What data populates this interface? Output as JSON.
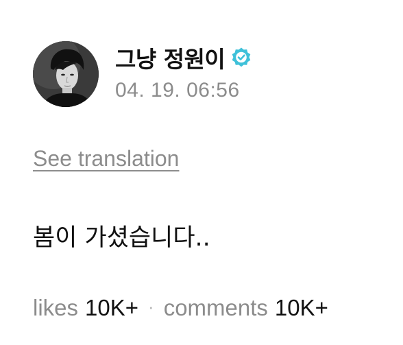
{
  "post": {
    "author": {
      "name": "그냥 정원이",
      "verified": true,
      "verified_icon": "verified-badge-icon",
      "verified_color": "#3fc1d9"
    },
    "timestamp": "04. 19. 06:56",
    "translation_link": "See translation",
    "body": "봄이 가셨습니다..",
    "stats": {
      "likes_label": "likes",
      "likes_value": "10K+",
      "separator": "·",
      "comments_label": "comments",
      "comments_value": "10K+"
    }
  }
}
